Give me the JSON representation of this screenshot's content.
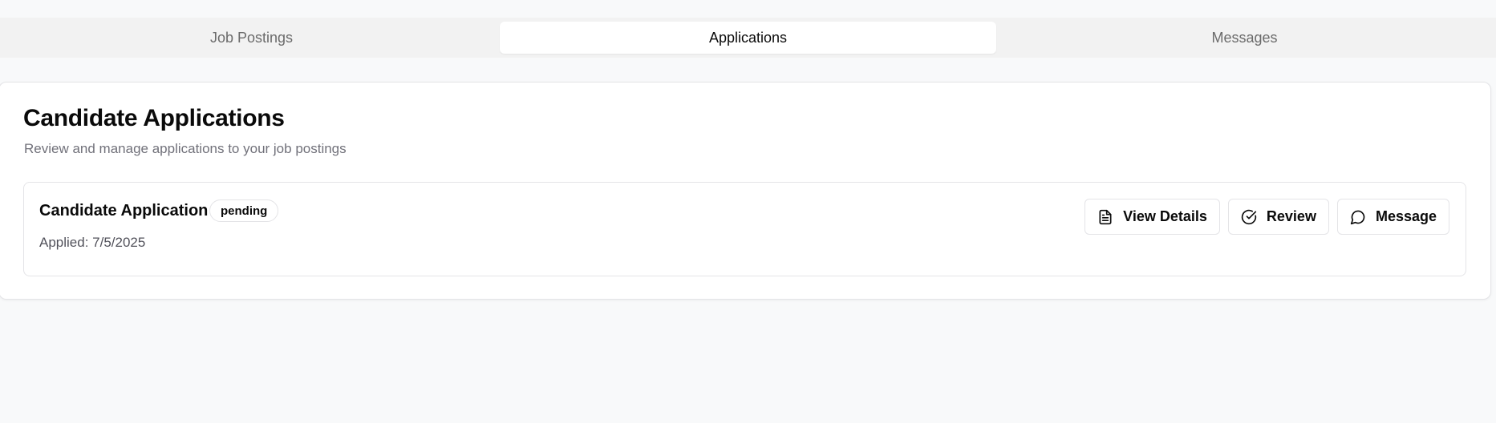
{
  "tabs": [
    {
      "label": "Job Postings",
      "active": false
    },
    {
      "label": "Applications",
      "active": true
    },
    {
      "label": "Messages",
      "active": false
    }
  ],
  "card": {
    "title": "Candidate Applications",
    "subtitle": "Review and manage applications to your job postings"
  },
  "applications": [
    {
      "name": "Candidate Application",
      "status": "pending",
      "applied": "Applied: 7/5/2025",
      "actions": [
        {
          "label": "View Details",
          "icon": "file-text-icon"
        },
        {
          "label": "Review",
          "icon": "check-circle-icon"
        },
        {
          "label": "Message",
          "icon": "message-circle-icon"
        }
      ]
    }
  ],
  "colors": {
    "background": "#f8f9fa",
    "tab_bar": "#f2f2f2",
    "muted_text": "#71717a",
    "border": "#e4e4e7"
  }
}
